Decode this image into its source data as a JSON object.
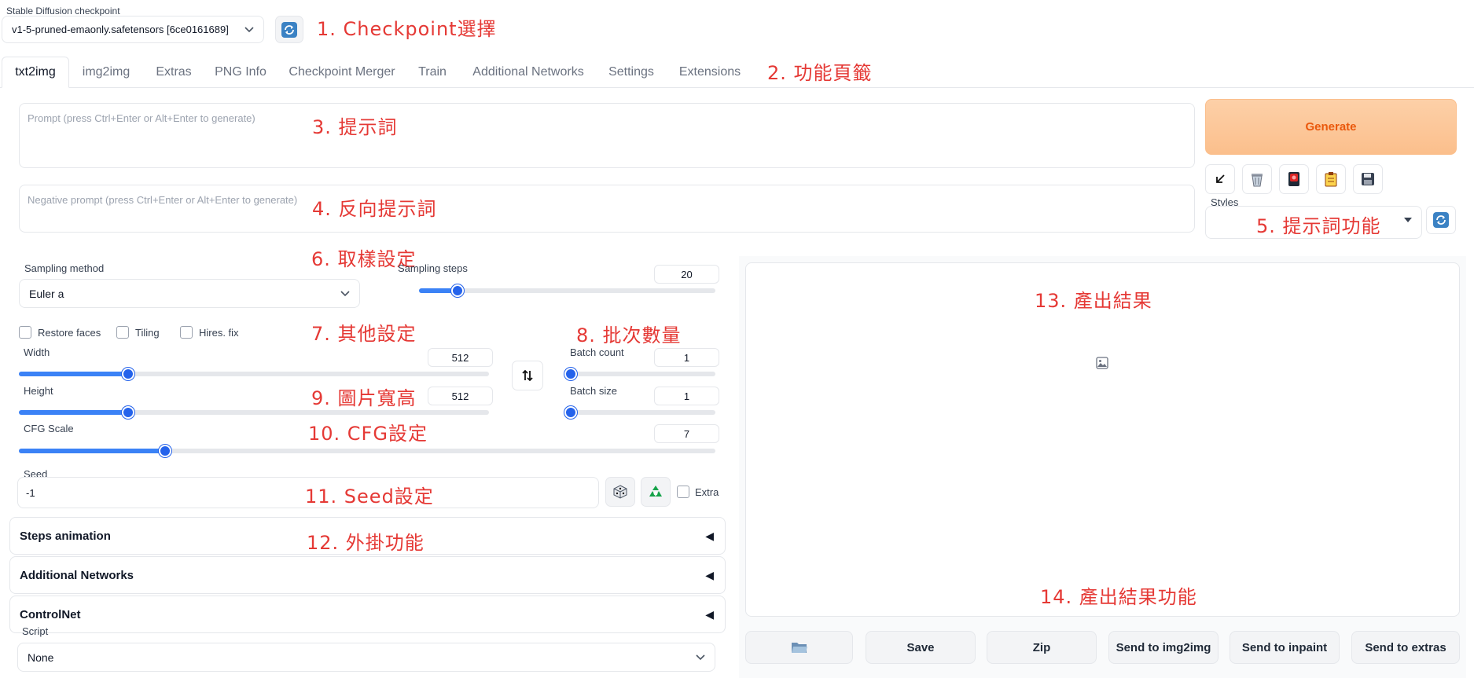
{
  "checkpoint": {
    "label": "Stable Diffusion checkpoint",
    "value": "v1-5-pruned-emaonly.safetensors [6ce0161689]"
  },
  "tabs": [
    {
      "label": "txt2img",
      "active": true
    },
    {
      "label": "img2img"
    },
    {
      "label": "Extras"
    },
    {
      "label": "PNG Info"
    },
    {
      "label": "Checkpoint Merger"
    },
    {
      "label": "Train"
    },
    {
      "label": "Additional Networks"
    },
    {
      "label": "Settings"
    },
    {
      "label": "Extensions"
    }
  ],
  "prompt": {
    "placeholder": "Prompt (press Ctrl+Enter or Alt+Enter to generate)"
  },
  "negative_prompt": {
    "placeholder": "Negative prompt (press Ctrl+Enter or Alt+Enter to generate)"
  },
  "generate": {
    "label": "Generate"
  },
  "styles": {
    "label": "Styles",
    "value": ""
  },
  "sampling": {
    "method_label": "Sampling method",
    "method_value": "Euler a",
    "steps_label": "Sampling steps",
    "steps_value": "20",
    "steps_fraction": 0.13
  },
  "options": {
    "restore_faces": "Restore faces",
    "tiling": "Tiling",
    "hires_fix": "Hires. fix"
  },
  "size": {
    "width_label": "Width",
    "width_value": "512",
    "width_fraction": 0.233,
    "height_label": "Height",
    "height_value": "512",
    "height_fraction": 0.233
  },
  "batch": {
    "count_label": "Batch count",
    "count_value": "1",
    "count_fraction": 0.0,
    "size_label": "Batch size",
    "size_value": "1",
    "size_fraction": 0.0
  },
  "cfg": {
    "label": "CFG Scale",
    "value": "7",
    "fraction": 0.21
  },
  "seed": {
    "label": "Seed",
    "value": "-1",
    "extra_label": "Extra"
  },
  "accordions": [
    "Steps animation",
    "Additional Networks",
    "ControlNet"
  ],
  "script": {
    "label": "Script",
    "value": "None"
  },
  "output_buttons": [
    "Save",
    "Zip",
    "Send to img2img",
    "Send to inpaint",
    "Send to extras"
  ],
  "annotations": {
    "a1": "1. Checkpoint選擇",
    "a2": "2. 功能頁籤",
    "a3": "3. 提示詞",
    "a4": "4. 反向提示詞",
    "a5": "5. 提示詞功能",
    "a6": "6. 取樣設定",
    "a7": "7. 其他設定",
    "a8": "8. 批次數量",
    "a9": "9. 圖片寬高",
    "a10": "10. CFG設定",
    "a11": "11. Seed設定",
    "a12": "12. 外掛功能",
    "a13": "13. 產出結果",
    "a14": "14. 產出結果功能"
  },
  "colors": {
    "accent": "#2563eb",
    "generate_bg": "#fdc596",
    "generate_text": "#ea580c",
    "annotation": "#e53935"
  },
  "icons": {
    "refresh": "refresh-icon",
    "arrow": "arrow-down-left-icon",
    "trash": "trash-icon",
    "card": "red-card-icon",
    "clipboard": "clipboard-icon",
    "save": "floppy-disk-icon",
    "swap": "swap-vertical-icon",
    "dice": "dice-icon",
    "recycle": "recycle-icon",
    "image": "image-placeholder-icon",
    "folder": "folder-icon"
  }
}
